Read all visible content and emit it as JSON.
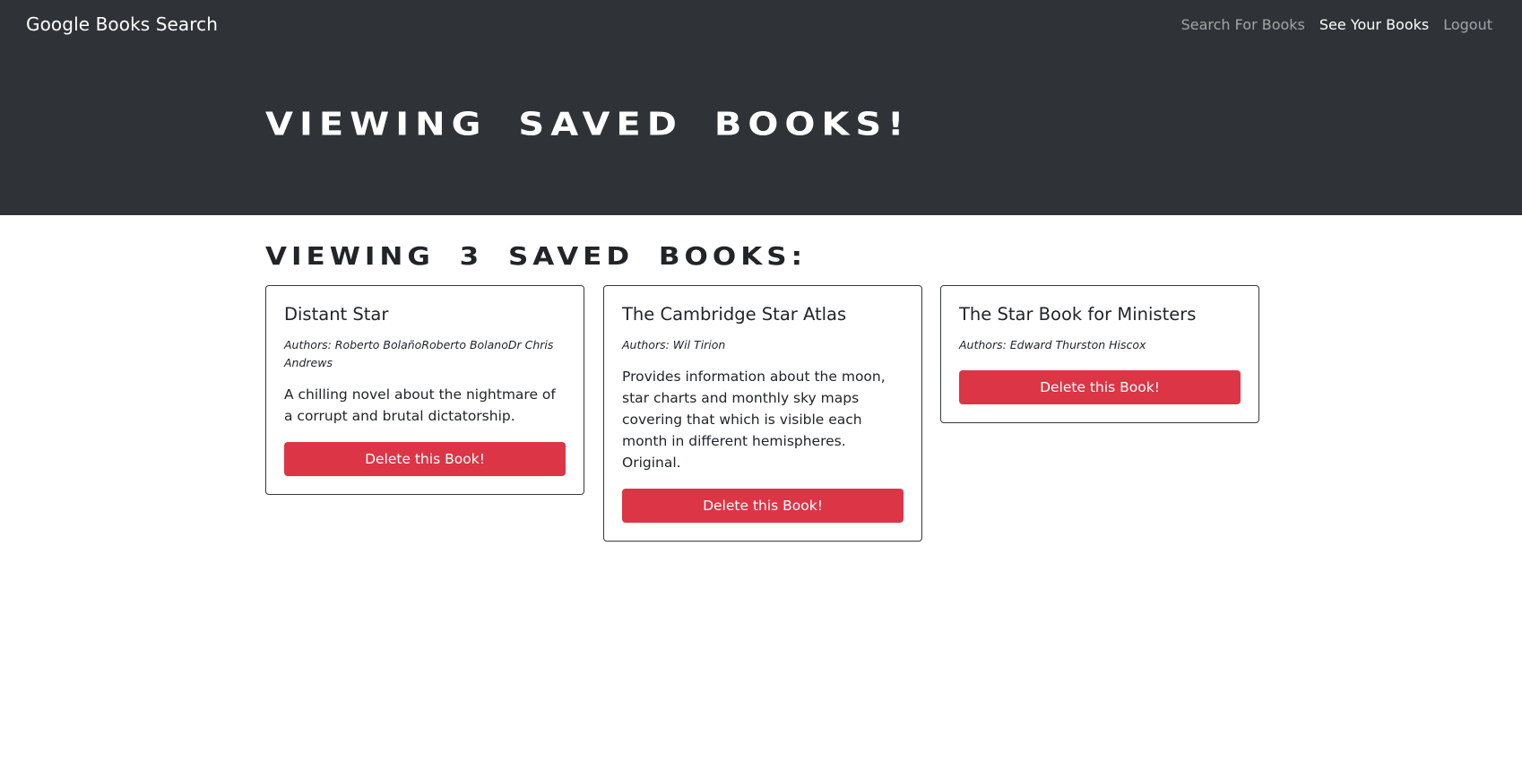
{
  "navbar": {
    "brand": "Google Books Search",
    "links": [
      {
        "label": "Search For Books",
        "active": false
      },
      {
        "label": "See Your Books",
        "active": true
      },
      {
        "label": "Logout",
        "active": false
      }
    ]
  },
  "hero": {
    "title": "Viewing saved books!"
  },
  "main": {
    "heading": "Viewing 3 saved books:",
    "books": [
      {
        "title": "Distant Star",
        "authors": "Authors: Roberto BolañoRoberto BolanoDr Chris Andrews",
        "description": "A chilling novel about the nightmare of a corrupt and brutal dictatorship.",
        "button_label": "Delete this Book!"
      },
      {
        "title": "The Cambridge Star Atlas",
        "authors": "Authors: Wil Tirion",
        "description": "Provides information about the moon, star charts and monthly sky maps covering that which is visible each month in different hemispheres. Original.",
        "button_label": "Delete this Book!"
      },
      {
        "title": "The Star Book for Ministers",
        "authors": "Authors: Edward Thurston Hiscox",
        "description": "",
        "button_label": "Delete this Book!"
      }
    ]
  },
  "colors": {
    "header_bg": "#2f3337",
    "danger": "#dc3545",
    "text": "#212529"
  }
}
